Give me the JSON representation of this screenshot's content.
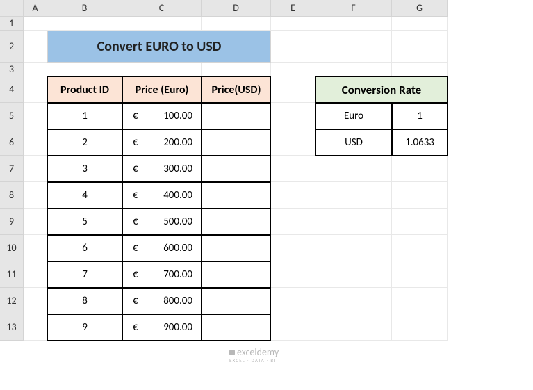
{
  "columns": [
    "A",
    "B",
    "C",
    "D",
    "E",
    "F",
    "G"
  ],
  "rows": [
    "1",
    "2",
    "3",
    "4",
    "5",
    "6",
    "7",
    "8",
    "9",
    "10",
    "11",
    "12",
    "13"
  ],
  "title": "Convert EURO to USD",
  "table": {
    "headers": [
      "Product ID",
      "Price (Euro)",
      "Price(USD)"
    ],
    "rows": [
      {
        "id": "1",
        "sym": "€",
        "price": "100.00",
        "usd": ""
      },
      {
        "id": "2",
        "sym": "€",
        "price": "200.00",
        "usd": ""
      },
      {
        "id": "3",
        "sym": "€",
        "price": "300.00",
        "usd": ""
      },
      {
        "id": "4",
        "sym": "€",
        "price": "400.00",
        "usd": ""
      },
      {
        "id": "5",
        "sym": "€",
        "price": "500.00",
        "usd": ""
      },
      {
        "id": "6",
        "sym": "€",
        "price": "600.00",
        "usd": ""
      },
      {
        "id": "7",
        "sym": "€",
        "price": "700.00",
        "usd": ""
      },
      {
        "id": "8",
        "sym": "€",
        "price": "800.00",
        "usd": ""
      },
      {
        "id": "9",
        "sym": "€",
        "price": "900.00",
        "usd": ""
      }
    ]
  },
  "conversion": {
    "title": "Conversion Rate",
    "rows": [
      {
        "label": "Euro",
        "value": "1"
      },
      {
        "label": "USD",
        "value": "1.0633"
      }
    ]
  },
  "watermark": {
    "brand": "exceldemy",
    "tagline": "EXCEL · DATA · BI"
  }
}
